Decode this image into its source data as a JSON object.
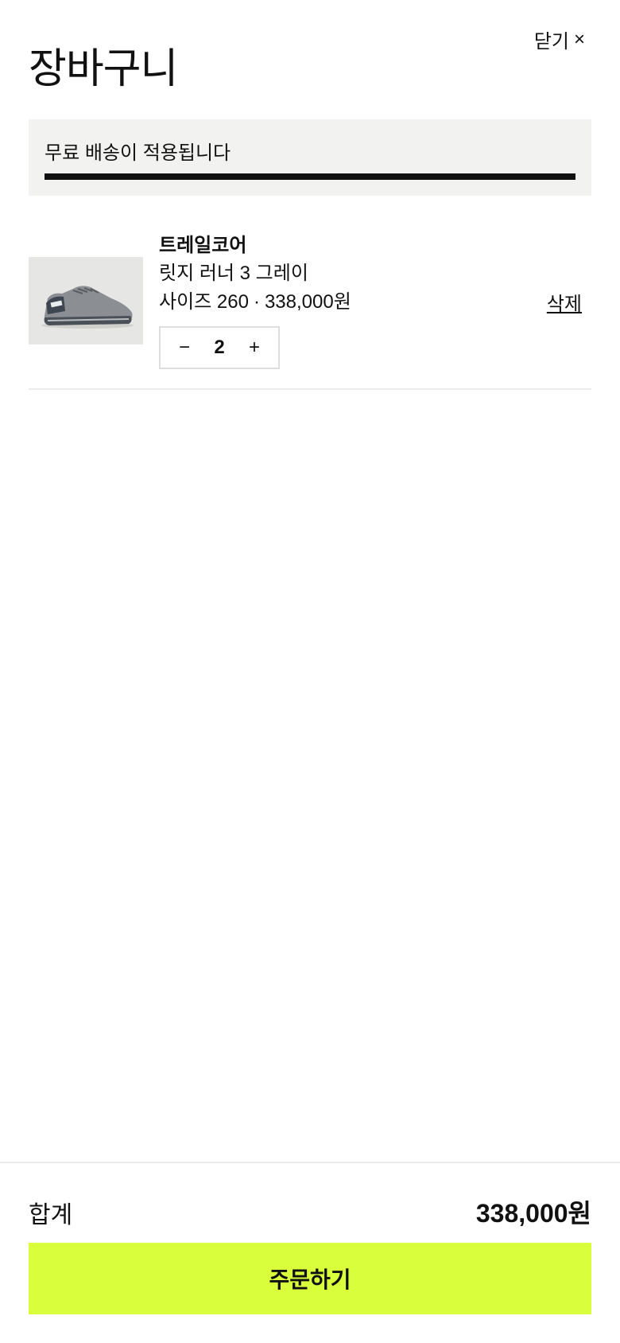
{
  "header": {
    "title": "장바구니",
    "close_label": "닫기",
    "close_icon": "×"
  },
  "shipping": {
    "message": "무료 배송이 적용됩니다",
    "progress_fraction": 1.0
  },
  "cart": {
    "items": [
      {
        "brand": "트레일코어",
        "name": "릿지 러너 3 그레이",
        "size": "사이즈 260",
        "separator": "·",
        "price": "338,000원",
        "quantity": "2",
        "decrease_icon": "−",
        "increase_icon": "+",
        "remove_label": "삭제",
        "image": "gray-trail-running-shoe"
      }
    ]
  },
  "footer": {
    "total_label": "합계",
    "total_value": "338,000원",
    "checkout_label": "주문하기"
  },
  "colors": {
    "accent": "#d9ff3c",
    "shipping_bg": "#f2f2f0",
    "progress": "#111111"
  }
}
